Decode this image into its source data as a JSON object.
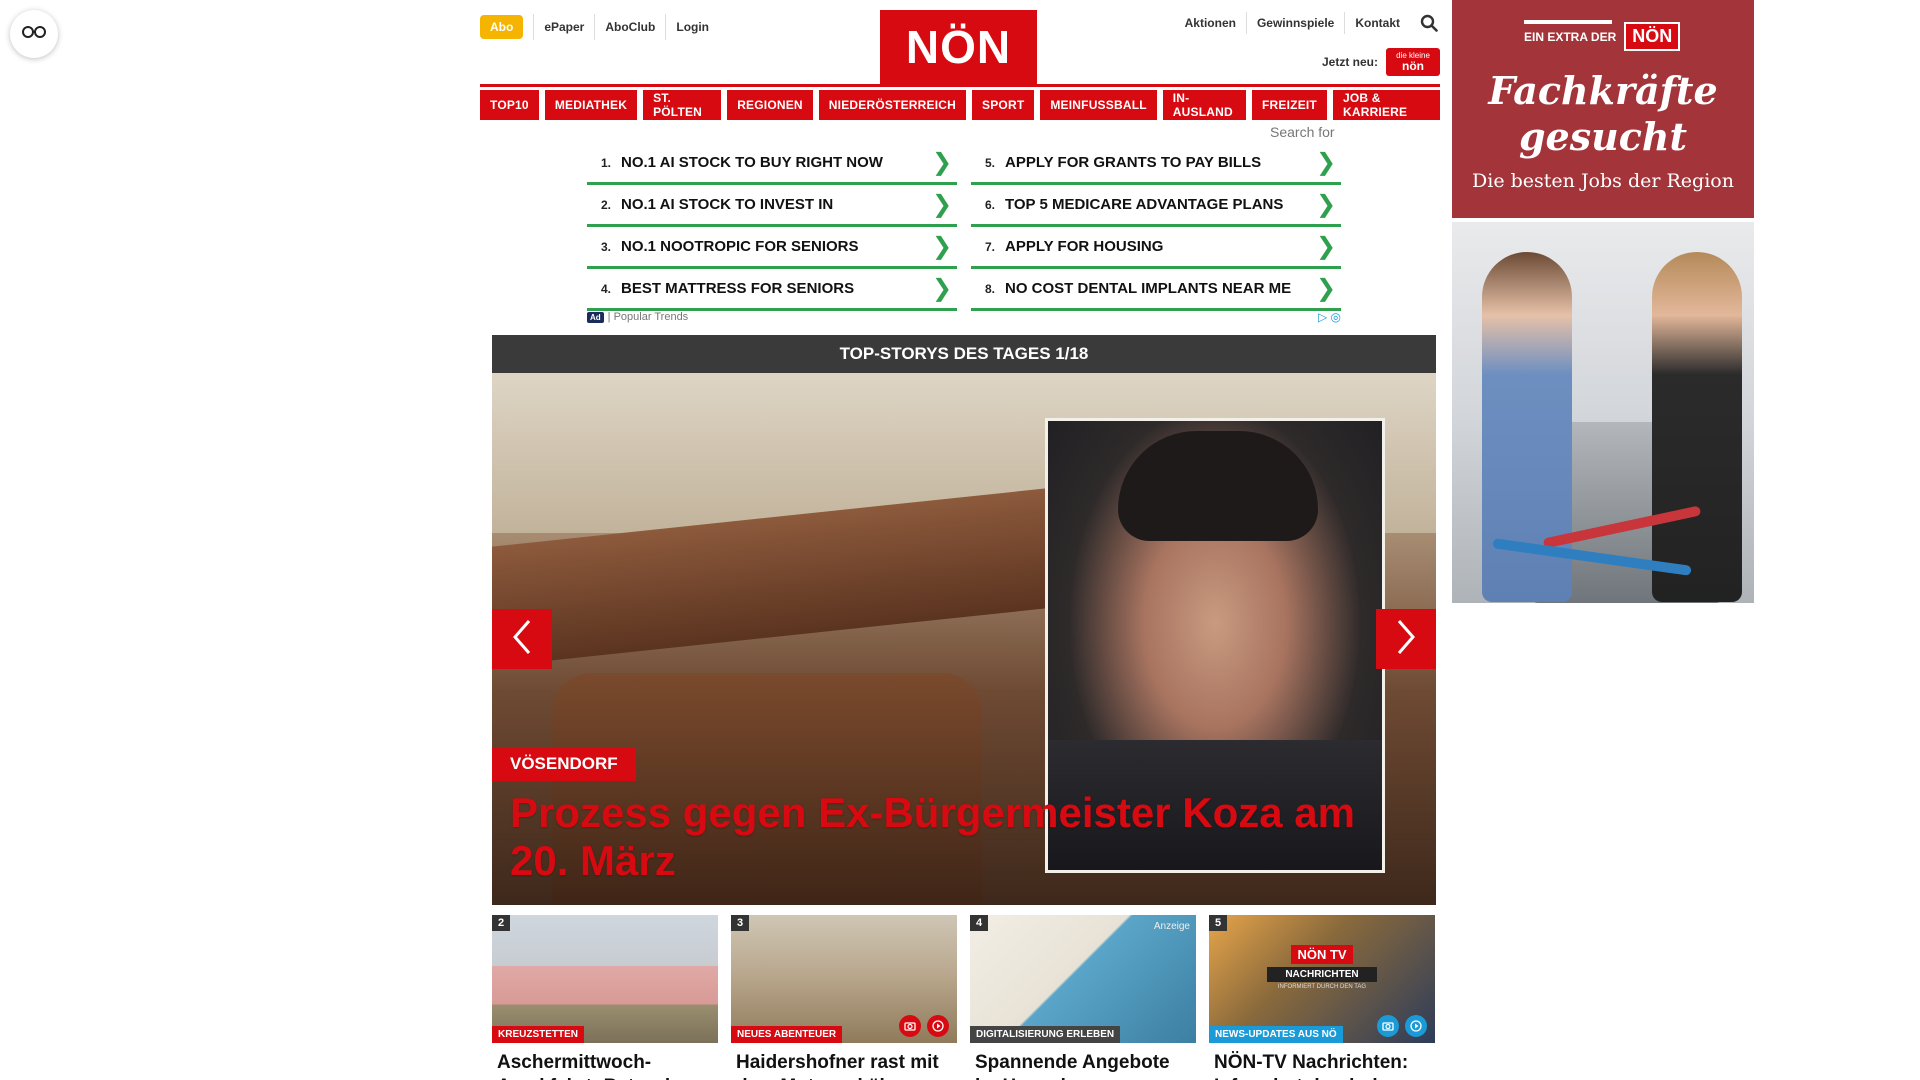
{
  "reader_button": {
    "icon": "glasses-icon"
  },
  "header": {
    "abo_label": "Abo",
    "top_links": [
      "ePaper",
      "AboClub",
      "Login"
    ],
    "logo_text": "NÖN",
    "right_links": [
      "Aktionen",
      "Gewinnspiele",
      "Kontakt"
    ],
    "search_icon": "search-icon",
    "jetzt_label": "Jetzt neu:",
    "jetzt_badge_top": "die kleine",
    "jetzt_badge_main": "nön"
  },
  "nav": [
    "TOP10",
    "MEDIATHEK",
    "ST. PÖLTEN",
    "REGIONEN",
    "NIEDERÖSTERREICH",
    "SPORT",
    "MEINFUSSBALL",
    "IN-AUSLAND",
    "FREIZEIT",
    "JOB & KARRIERE"
  ],
  "search_for": "Search for",
  "ad_list": [
    {
      "num": "1.",
      "text": "NO.1 AI STOCK TO BUY RIGHT NOW"
    },
    {
      "num": "5.",
      "text": "APPLY FOR GRANTS TO PAY BILLS"
    },
    {
      "num": "2.",
      "text": "NO.1 AI STOCK TO INVEST IN"
    },
    {
      "num": "6.",
      "text": "TOP 5 MEDICARE ADVANTAGE PLANS"
    },
    {
      "num": "3.",
      "text": "NO.1 NOOTROPIC FOR SENIORS"
    },
    {
      "num": "7.",
      "text": "APPLY FOR HOUSING"
    },
    {
      "num": "4.",
      "text": "BEST MATTRESS FOR SENIORS"
    },
    {
      "num": "8.",
      "text": "NO COST DENTAL IMPLANTS NEAR ME"
    }
  ],
  "ad_footer": {
    "mark": "Ad",
    "label": "| Popular Trends"
  },
  "top_stories": {
    "bar_title": "TOP-STORYS DES TAGES 1/18",
    "hero": {
      "kicker": "VÖSENDORF",
      "title": "Prozess gegen Ex-Bürgermeister Koza am 20. März"
    },
    "cards": [
      {
        "num": "2",
        "kicker": "KREUZSTETTEN",
        "title": "Aschermittwoch-Amokfahrt: Betrunken"
      },
      {
        "num": "3",
        "kicker": "NEUES ABENTEUER",
        "title": "Haidershofner rast mit dem Motorrad über"
      },
      {
        "num": "4",
        "kicker": "DIGITALISIERUNG ERLEBEN",
        "ad": "Anzeige",
        "title": "Spannende Angebote im Haus der Digitalisierung"
      },
      {
        "num": "5",
        "kicker": "NEWS-UPDATES AUS NÖ",
        "title": "NÖN-TV Nachrichten: Informiert durch den Tag",
        "tv_logo": "NÖN TV",
        "tv_sub": "NACHRICHTEN",
        "tv_small": "INFORMIERT DURCH DEN TAG"
      }
    ]
  },
  "side_ad": {
    "extra_label": "EIN EXTRA DER",
    "logo": "NÖN",
    "title": "Fachkräfte gesucht",
    "subtitle": "Die besten Jobs der Region"
  },
  "colors": {
    "brand_red": "#d70a12",
    "abo_yellow": "#f5b400",
    "ad_green": "#2fa04e",
    "side_ad_red": "#a3343a"
  }
}
